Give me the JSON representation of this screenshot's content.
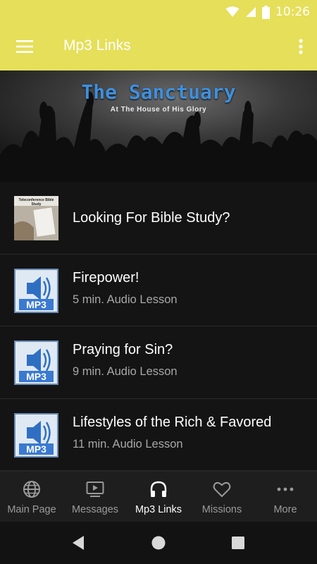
{
  "status_bar": {
    "time": "10:26"
  },
  "app_bar": {
    "title": "Mp3 Links"
  },
  "banner": {
    "title": "The Sanctuary",
    "subtitle": "At The House of His Glory"
  },
  "list": {
    "items": [
      {
        "title": "Looking For Bible Study?",
        "subtitle": "",
        "thumb": "Teleconference Bible Study"
      },
      {
        "title": "Firepower!",
        "subtitle": "5 min. Audio Lesson",
        "thumb": "MP3"
      },
      {
        "title": "Praying for Sin?",
        "subtitle": "9 min. Audio Lesson",
        "thumb": "MP3"
      },
      {
        "title": "Lifestyles of the Rich & Favored",
        "subtitle": "11 min. Audio Lesson",
        "thumb": "MP3"
      }
    ]
  },
  "bottom_nav": {
    "items": [
      {
        "label": "Main Page",
        "icon": "globe-icon"
      },
      {
        "label": "Messages",
        "icon": "video-icon"
      },
      {
        "label": "Mp3 Links",
        "icon": "headphones-icon",
        "active": true
      },
      {
        "label": "Missions",
        "icon": "heart-icon"
      },
      {
        "label": "More",
        "icon": "more-dots-icon"
      }
    ]
  },
  "colors": {
    "app_bar": "#e6df5a",
    "background": "#141414",
    "banner_title": "#3f8fdc"
  }
}
